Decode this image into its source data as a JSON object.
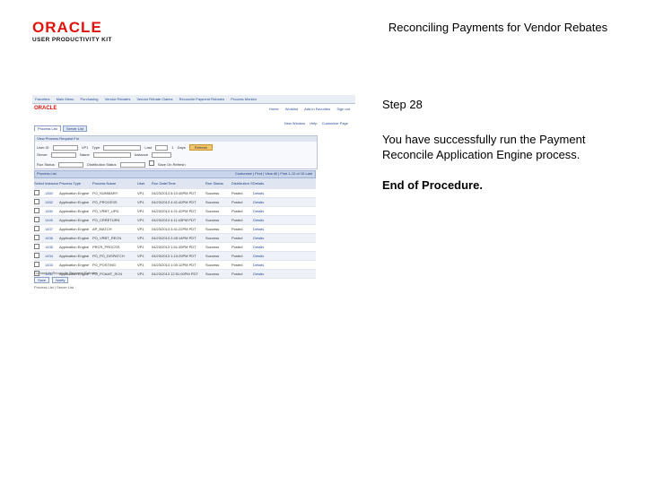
{
  "header": {
    "logo_word": "ORACLE",
    "logo_sub": "USER PRODUCTIVITY KIT",
    "title": "Reconciling Payments for Vendor Rebates"
  },
  "step": {
    "title": "Step 28",
    "message": "You have successfully run the Payment Reconcile Application Engine process.",
    "end": "End of Procedure."
  },
  "screenshot": {
    "breadcrumb": [
      "Favorites",
      "Main Menu",
      "Purchasing",
      "Vendor Rebates",
      "Vendor Rebate Claims",
      "Reconcile Payment Rebates",
      "Process Monitor"
    ],
    "oracle_mini": "ORACLE",
    "top_links": [
      "Home",
      "Worklist",
      "Add to Favorites",
      "Sign out"
    ],
    "new_window_links": [
      "New Window",
      "Help",
      "Customize Page"
    ],
    "tabs": [
      "Process List",
      "Server List"
    ],
    "request_title": "View Process Request For",
    "filters": {
      "user_id_label": "User ID",
      "user_id": "VP1",
      "type_label": "Type",
      "type_value": "",
      "last_label": "Last",
      "last_value": "1",
      "unit_value": "Days",
      "refresh": "Refresh",
      "server_label": "Server",
      "name_label": "Name",
      "instance_label": "Instance",
      "run_status_label": "Run Status",
      "dist_status_label": "Distribution Status",
      "save_on_refresh": "Save On Refresh"
    },
    "process_list": {
      "title": "Process List",
      "nav": "Customize | Find | View All | First 1-10 of 10 Last",
      "headers": [
        "Select",
        "Instance",
        "Seq.",
        "Process Type",
        "Process Name",
        "User",
        "Run Date/Time",
        "Run Status",
        "Distribution Status",
        "Details"
      ],
      "rows": [
        [
          "1460",
          "Application Engine",
          "PO_SUMMARY",
          "VP1",
          "04/23/2013 5:10:45PM PDT",
          "Success",
          "Posted",
          "Details"
        ],
        [
          "1452",
          "Application Engine",
          "PO_PROCESS",
          "VP1",
          "04/23/2013 4:41:40PM PDT",
          "Success",
          "Posted",
          "Details"
        ],
        [
          "1450",
          "Application Engine",
          "PO_VRBT_UPD",
          "VP1",
          "04/23/2013 4:21:42PM PDT",
          "Success",
          "Posted",
          "Details"
        ],
        [
          "1449",
          "Application Engine",
          "PO_CRRETURN",
          "VP1",
          "04/23/2013 4:11:43PM PDT",
          "Success",
          "Posted",
          "Details"
        ],
        [
          "1437",
          "Application Engine",
          "AP_MATCH",
          "VP1",
          "04/23/2013 3:41:22PM PDT",
          "Success",
          "Posted",
          "Details"
        ],
        [
          "1436",
          "Application Engine",
          "PO_VRBT_RECN",
          "VP1",
          "04/23/2013 2:45:14PM PDT",
          "Success",
          "Posted",
          "Details"
        ],
        [
          "1435",
          "Application Engine",
          "PRCR_PROCSS",
          "VP1",
          "04/23/2013 1:51:35PM PDT",
          "Success",
          "Posted",
          "Details"
        ],
        [
          "1434",
          "Application Engine",
          "PO_PO_DISPATCH",
          "VP1",
          "04/23/2013 1:10:20PM PDT",
          "Success",
          "Posted",
          "Details"
        ],
        [
          "1433",
          "Application Engine",
          "PO_POSTING",
          "VP1",
          "04/23/2013 1:00:12PM PDT",
          "Success",
          "Posted",
          "Details"
        ],
        [
          "1432",
          "Application Engine",
          "PO_POAMT_RCN",
          "VP1",
          "04/23/2013 12:51:00PM PDT",
          "Success",
          "Posted",
          "Details"
        ]
      ]
    },
    "footer": {
      "return_link": "Go back to Reconcile Payment Rebates",
      "buttons": [
        "Save",
        "Notify"
      ],
      "bottom_links": "Process List | Server List"
    }
  }
}
